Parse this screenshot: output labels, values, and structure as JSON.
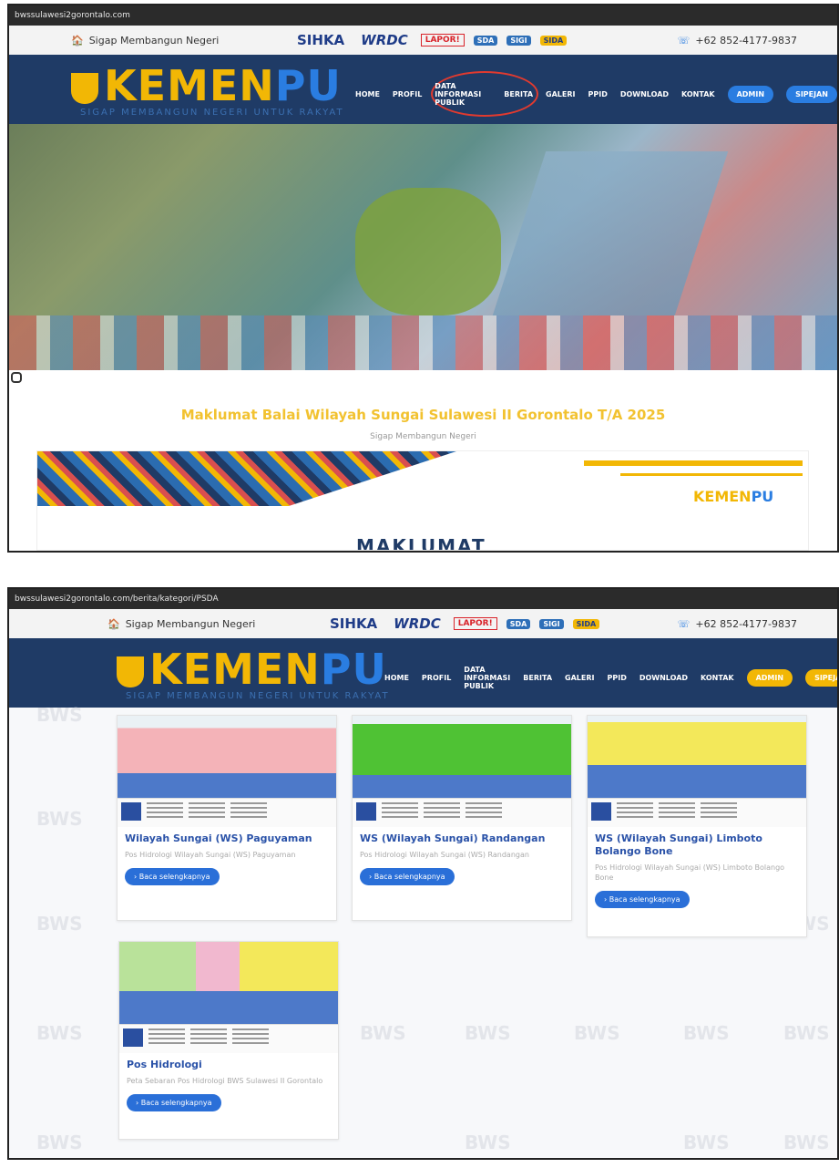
{
  "shot1": {
    "url": "bwssulawesi2gorontalo.com",
    "tagline": "Sigap Membangun Negeri",
    "logos": [
      "SIHKA",
      "WRDC",
      "LAPOR!",
      "SDA",
      "SIGI",
      "SIDA"
    ],
    "phone": "+62 852-4177-9837",
    "brand_main": "KEMEN",
    "brand_pu": "PU",
    "brand_sub": "SIGAP MEMBANGUN NEGERI UNTUK RAKYAT",
    "menu": [
      "HOME",
      "PROFIL",
      "DATA INFORMASI PUBLIK",
      "BERITA",
      "GALERI",
      "PPID",
      "DOWNLOAD",
      "KONTAK"
    ],
    "btn_admin": "ADMIN",
    "btn_sipejan": "SIPEJAN",
    "maklumat_title": "Maklumat Balai Wilayah Sungai Sulawesi II Gorontalo T/A 2025",
    "maklumat_sub": "Sigap Membangun Negeri",
    "banner_badge_main": "KEMEN",
    "banner_badge_pu": "PU",
    "banner_word": "MAKLUMAT"
  },
  "shot2": {
    "url": "bwssulawesi2gorontalo.com/berita/kategori/PSDA",
    "tagline": "Sigap Membangun Negeri",
    "logos": [
      "SIHKA",
      "WRDC",
      "LAPOR!",
      "SDA",
      "SIGI",
      "SIDA"
    ],
    "phone": "+62 852-4177-9837",
    "brand_main": "KEMEN",
    "brand_pu": "PU",
    "brand_sub": "SIGAP MEMBANGUN NEGERI UNTUK RAKYAT",
    "menu": [
      "HOME",
      "PROFIL",
      "DATA INFORMASI PUBLIK",
      "BERITA",
      "GALERI",
      "PPID",
      "DOWNLOAD",
      "KONTAK"
    ],
    "btn_admin": "ADMIN",
    "btn_sipejan": "SIPEJAN",
    "watermark": "BWS",
    "cards": [
      {
        "title": "Wilayah Sungai (WS) Paguyaman",
        "desc": "Pos Hidrologi Wilayah Sungai (WS) Paguyaman",
        "cta": "Baca selengkapnya"
      },
      {
        "title": "WS (Wilayah Sungai) Randangan",
        "desc": "Pos Hidrologi Wilayah Sungai (WS) Randangan",
        "cta": "Baca selengkapnya"
      },
      {
        "title": "WS (Wilayah Sungai) Limboto Bolango Bone",
        "desc": "Pos Hidrologi Wilayah Sungai (WS) Limboto Bolango Bone",
        "cta": "Baca selengkapnya"
      },
      {
        "title": "Pos Hidrologi",
        "desc": "Peta Sebaran Pos Hidrologi BWS Sulawesi II Gorontalo",
        "cta": "Baca selengkapnya"
      }
    ]
  },
  "colors": {
    "navy": "#1f3b66",
    "gold": "#f2b705",
    "blue": "#2a7de1",
    "highlight": "#e03a2f"
  }
}
